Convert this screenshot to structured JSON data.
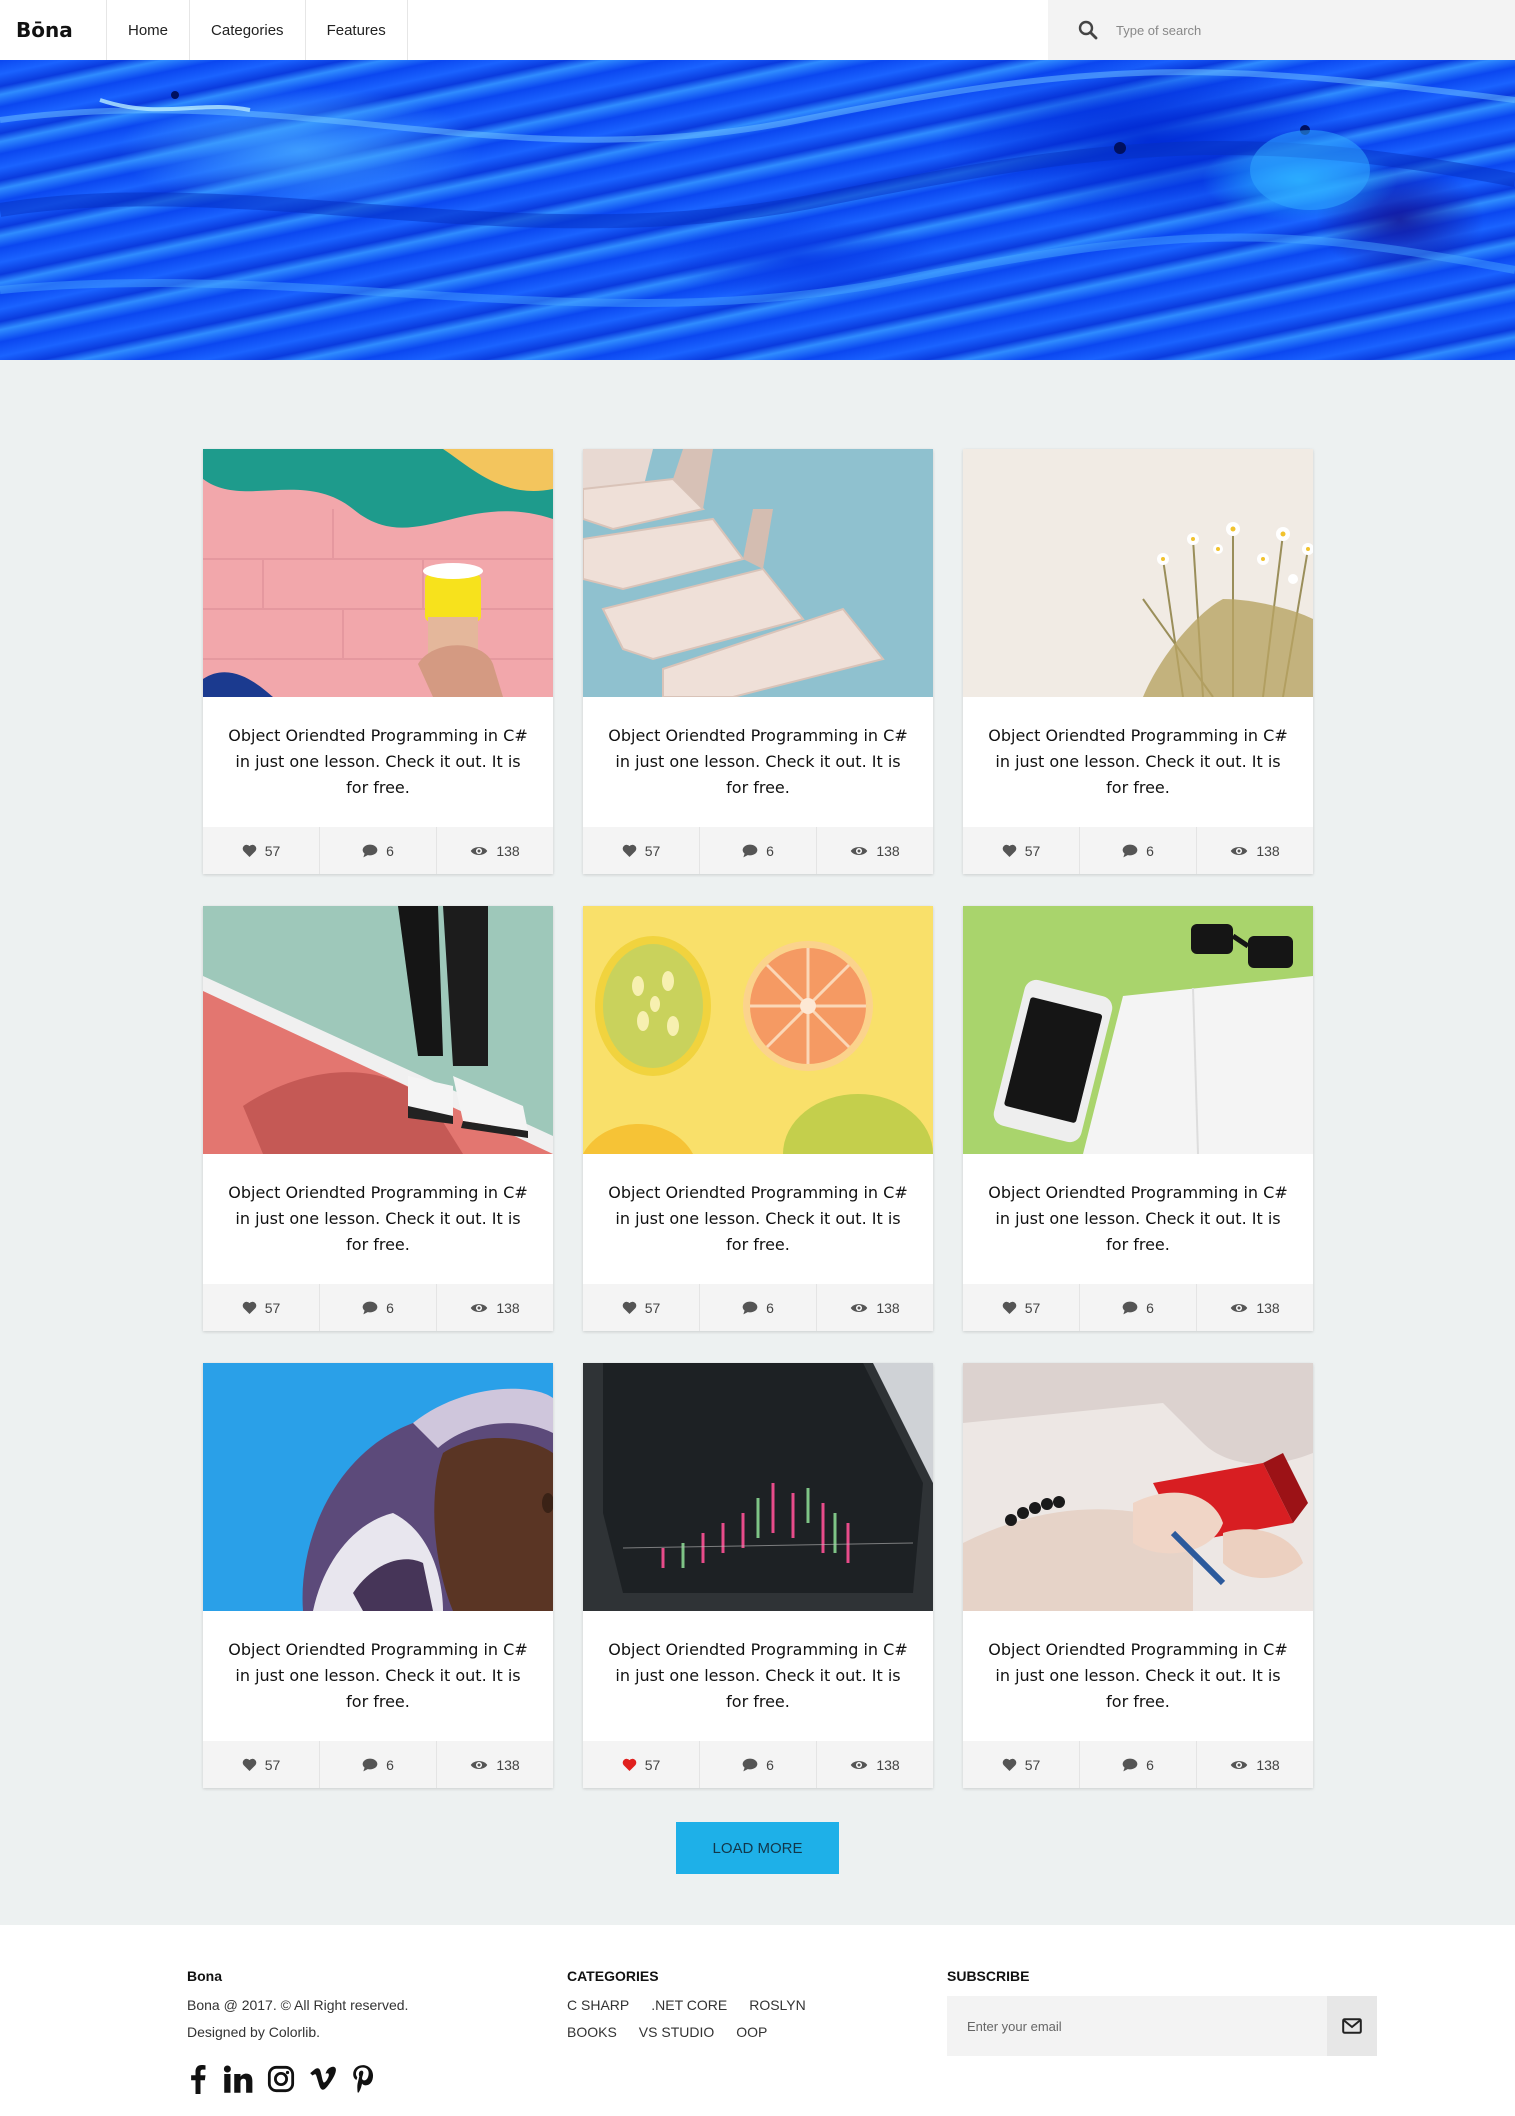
{
  "header": {
    "logo": "Bōna",
    "nav": [
      "Home",
      "Categories",
      "Features"
    ],
    "search_placeholder": "Type of search"
  },
  "posts": [
    {
      "title": "Object Oriendted Programming in C# in just one lesson. Check it out. It is for free.",
      "likes": "57",
      "comments": "6",
      "views": "138",
      "liked": false
    },
    {
      "title": "Object Oriendted Programming in C# in just one lesson. Check it out. It is for free.",
      "likes": "57",
      "comments": "6",
      "views": "138",
      "liked": false
    },
    {
      "title": "Object Oriendted Programming in C# in just one lesson. Check it out. It is for free.",
      "likes": "57",
      "comments": "6",
      "views": "138",
      "liked": false
    },
    {
      "title": "Object Oriendted Programming in C# in just one lesson. Check it out. It is for free.",
      "likes": "57",
      "comments": "6",
      "views": "138",
      "liked": false
    },
    {
      "title": "Object Oriendted Programming in C# in just one lesson. Check it out. It is for free.",
      "likes": "57",
      "comments": "6",
      "views": "138",
      "liked": false
    },
    {
      "title": "Object Oriendted Programming in C# in just one lesson. Check it out. It is for free.",
      "likes": "57",
      "comments": "6",
      "views": "138",
      "liked": false
    },
    {
      "title": "Object Oriendted Programming in C# in just one lesson. Check it out. It is for free.",
      "likes": "57",
      "comments": "6",
      "views": "138",
      "liked": false
    },
    {
      "title": "Object Oriendted Programming in C# in just one lesson. Check it out. It is for free.",
      "likes": "57",
      "comments": "6",
      "views": "138",
      "liked": true
    },
    {
      "title": "Object Oriendted Programming in C# in just one lesson. Check it out. It is for free.",
      "likes": "57",
      "comments": "6",
      "views": "138",
      "liked": false
    }
  ],
  "load_more": "LOAD MORE",
  "footer": {
    "brand": "Bona",
    "copyright": "Bona @ 2017. © All Right reserved.",
    "designed": "Designed by Colorlib.",
    "social_icons": [
      "facebook-icon",
      "linkedin-icon",
      "instagram-icon",
      "vimeo-icon",
      "pinterest-icon"
    ],
    "categories_title": "CATEGORIES",
    "categories": [
      "C SHARP",
      ".NET CORE",
      "ROSLYN",
      "BOOKS",
      "VS STUDIO",
      "OOP"
    ],
    "subscribe_title": "SUBSCRIBE",
    "email_placeholder": "Enter your email"
  },
  "colors": {
    "accent": "#1eb0e8",
    "liked": "#e0201e",
    "background": "#edf1f1"
  }
}
